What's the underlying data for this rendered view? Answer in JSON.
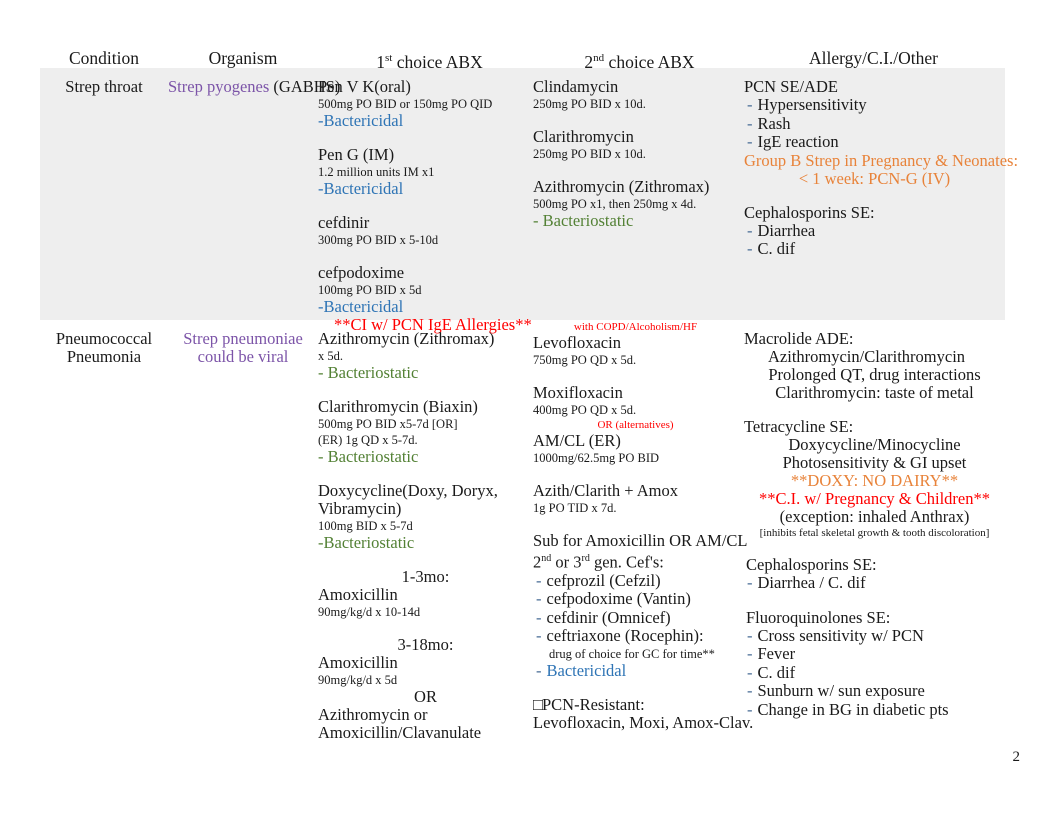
{
  "page_number": "2",
  "headers": {
    "condition": "Condition",
    "organism": "Organism",
    "first_choice_num": "1",
    "first_choice_sup": "st",
    "first_choice_rest": "choice ABX",
    "second_choice_num": "2",
    "second_choice_sup": "nd",
    "second_choice_rest": "choice ABX",
    "allergy": "Allergy/C.I./Other"
  },
  "colors": {
    "bactericidal": "#2E74B5",
    "bacteriostatic": "#538135",
    "organism": "#7C54A8",
    "orange_note": "#E8833A",
    "red_note": "#FF0000",
    "bullet_dash": "#4A6E96",
    "row_shade": "#EEEEEE"
  },
  "rows": [
    {
      "condition": "Strep throat",
      "organism_name": "Strep pyogenes",
      "organism_suffix": "(GABHS)",
      "first_choice": {
        "drug1_name": "Pen V K(oral)",
        "drug1_dose": "500mg PO BID or 150mg PO QID",
        "drug1_class": "-Bactericidal",
        "drug2_name": "Pen G (IM)",
        "drug2_dose": "1.2 million units IM x1",
        "drug2_class": "-Bactericidal",
        "drug3_name": "cefdinir",
        "drug3_dose": "300mg PO BID x 5-10d",
        "drug4_name": "cefpodoxime",
        "drug4_dose": "100mg PO BID x 5d",
        "drug4_class": "-Bactericidal",
        "warning": "**CI w/ PCN IgE Allergies**"
      },
      "second_choice": {
        "drug1_name": "Clindamycin",
        "drug1_dose": "250mg PO BID x 10d.",
        "drug2_name": "Clarithromycin",
        "drug2_dose": "250mg PO BID x 10d.",
        "drug3_name": "Azithromycin (Zithromax)",
        "drug3_dose": "500mg PO x1, then 250mg x 4d.",
        "drug3_class": "- Bacteriostatic"
      },
      "allergy": {
        "pcn_title": "PCN SE/ADE",
        "pcn_items": [
          "Hypersensitivity",
          "Rash",
          "IgE reaction"
        ],
        "gbs_line1": "Group B Strep in Pregnancy & Neonates:",
        "gbs_line2": "< 1 week: PCN-G (IV)",
        "ceph_title": "Cephalosporins SE:",
        "ceph_items": [
          "Diarrhea",
          "C. dif"
        ]
      }
    },
    {
      "condition_line1": "Pneumococcal",
      "condition_line2": "Pneumonia",
      "organism_line1": "Strep pneumoniae",
      "organism_line2": "could be viral",
      "first_choice": {
        "drug1_name": "Azithromycin (Zithromax)",
        "drug1_dose": "x 5d.",
        "drug1_class": "- Bacteriostatic",
        "drug2_name": "Clarithromycin (Biaxin)",
        "drug2_dose1": "500mg PO BID x5-7d [OR]",
        "drug2_dose2": "(ER) 1g QD x 5-7d.",
        "drug2_class": "- Bacteriostatic",
        "drug3_name_line1": "Doxycycline(Doxy, Doryx,",
        "drug3_name_line2": "Vibramycin)",
        "drug3_dose": "100mg BID x 5-7d",
        "drug3_class": "-Bacteriostatic",
        "peds1_header": "1-3mo:",
        "peds1_drug": "Amoxicillin",
        "peds1_dose": "90mg/kg/d x 10-14d",
        "peds2_header": "3-18mo:",
        "peds2_drug": "Amoxicillin",
        "peds2_dose": "90mg/kg/d x 5d",
        "peds2_or": "OR",
        "peds2_alt_line1": "Azithromycin or",
        "peds2_alt_line2": "Amoxicillin/Clavanulate"
      },
      "second_choice": {
        "copd_note": "with COPD/Alcoholism/HF",
        "drug1_name": "Levofloxacin",
        "drug1_dose": "750mg PO QD x 5d.",
        "drug2_name": "Moxifloxacin",
        "drug2_dose": "400mg PO QD x 5d.",
        "alt_note": "OR (alternatives)",
        "drug3_name": "AM/CL (ER)",
        "drug3_dose": "1000mg/62.5mg PO BID",
        "drug4_name": "Azith/Clarith + Amox",
        "drug4_dose": "1g PO TID x 7d.",
        "sub_line1": "Sub for Amoxicillin OR AM/CL",
        "sub_line2_a": "2",
        "sub_line2_sup_a": "nd",
        "sub_line2_b": "or 3",
        "sub_line2_sup_b": "rd",
        "sub_line2_c": "gen. Cef's:",
        "sub_items": [
          "cefprozil (Cefzil)",
          "cefpodoxime (Vantin)",
          "cefdinir (Omnicef)",
          "ceftriaxone (Rocephin):"
        ],
        "sub_item4_note": "drug of choice for GC for time**",
        "sub_class": "Bactericidal",
        "pcn_res_title": "PCN-Resistant:",
        "pcn_res_drugs": "Levofloxacin, Moxi, Amox-Clav."
      },
      "allergy": {
        "macrolide_title": "Macrolide ADE:",
        "macrolide_items": [
          "Azithromycin/Clarithromycin",
          "Prolonged QT, drug interactions",
          "Clarithromycin: taste of metal"
        ],
        "tetra_title": "Tetracycline SE:",
        "tetra_items": [
          "Doxycycline/Minocycline",
          "Photosensitivity & GI upset"
        ],
        "tetra_doxy_warn": "**DOXY: NO DAIRY**",
        "tetra_ci_warn": "**C.I. w/ Pregnancy & Children**",
        "tetra_exception": "(exception: inhaled Anthrax)",
        "tetra_footnote": "[inhibits fetal skeletal growth & tooth discoloration]",
        "ceph_title": "Cephalosporins SE:",
        "ceph_items": [
          "Diarrhea / C. dif"
        ],
        "fq_title": "Fluoroquinolones SE:",
        "fq_items": [
          "Cross sensitivity w/ PCN",
          "Fever",
          "C. dif",
          "Sunburn w/ sun exposure",
          "Change in BG in diabetic pts"
        ]
      }
    }
  ]
}
